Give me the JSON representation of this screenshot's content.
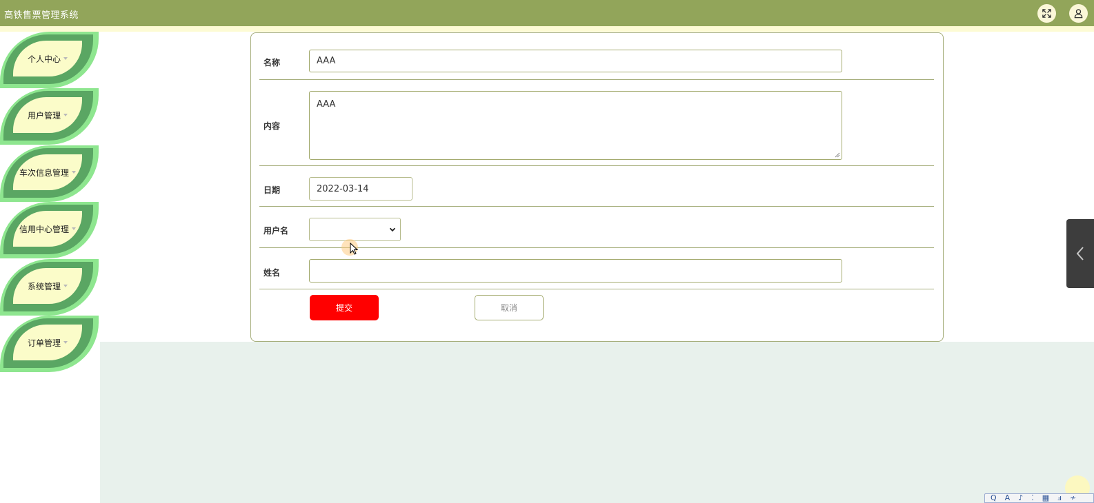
{
  "app": {
    "title": "高铁售票管理系统"
  },
  "header": {
    "fullscreen_icon": "fullscreen-icon",
    "user_icon": "user-icon"
  },
  "sidebar": {
    "items": [
      {
        "label": "个人中心"
      },
      {
        "label": "用户管理"
      },
      {
        "label": "车次信息管理"
      },
      {
        "label": "信用中心管理"
      },
      {
        "label": "系统管理"
      },
      {
        "label": "订单管理"
      }
    ]
  },
  "form": {
    "name": {
      "label": "名称",
      "value": "AAA"
    },
    "content": {
      "label": "内容",
      "value": "AAA"
    },
    "date": {
      "label": "日期",
      "value": "2022-03-14"
    },
    "username": {
      "label": "用户名",
      "value": ""
    },
    "realname": {
      "label": "姓名",
      "value": ""
    },
    "submit_label": "提交",
    "cancel_label": "取消"
  },
  "drawer": {
    "icon": "chevron-left-icon"
  },
  "tray": {
    "items": [
      "Q",
      "A",
      "♪",
      "⁚",
      "▦",
      "ⅎ",
      "≁"
    ]
  },
  "colors": {
    "header_bg": "#92a55a",
    "leaf_light": "#8ee68f",
    "leaf_dark": "#5aa663",
    "leaf_center": "#fbfcc9",
    "submit_bg": "#ff0000",
    "border_olive": "#a5ad7a",
    "content_bg": "#e8f1ec"
  }
}
